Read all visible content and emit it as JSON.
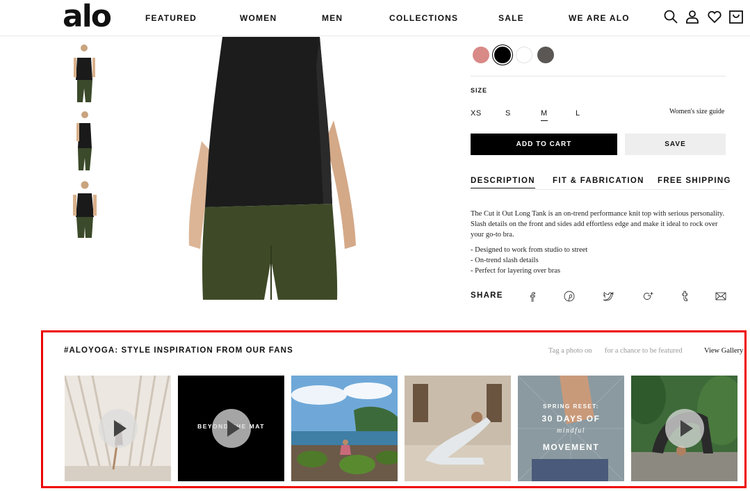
{
  "header": {
    "logo": "alo",
    "nav": [
      "FEATURED",
      "WOMEN",
      "MEN",
      "COLLECTIONS",
      "SALE",
      "WE ARE ALO"
    ],
    "icons": [
      "search-icon",
      "account-icon",
      "wishlist-icon",
      "cart-icon"
    ]
  },
  "product": {
    "colors": [
      "#d98a87",
      "#000000",
      "#ffffff",
      "#5a5754"
    ],
    "selected_color_index": 1,
    "size_label": "SIZE",
    "sizes": [
      "XS",
      "S",
      "M",
      "L"
    ],
    "selected_size": "M",
    "size_guide": "Women's size guide",
    "add_to_cart": "ADD TO CART",
    "save": "SAVE",
    "tabs": [
      "DESCRIPTION",
      "FIT & FABRICATION",
      "FREE SHIPPING"
    ],
    "active_tab": "DESCRIPTION",
    "description": "The Cut it Out Long Tank is an on-trend performance knit top with serious personality. Slash details on the front and sides add effortless edge and make it ideal to rock over your go-to bra.",
    "bullets": [
      "- Designed to work from studio to street",
      "- On-trend slash details",
      "- Perfect for layering over bras"
    ],
    "share_label": "SHARE",
    "share_icons": [
      "facebook-icon",
      "pinterest-icon",
      "twitter-icon",
      "google-plus-icon",
      "tumblr-icon",
      "email-icon"
    ]
  },
  "inspiration": {
    "title": "#ALOYOGA: STYLE INSPIRATION FROM OUR FANS",
    "tag_text": "Tag a photo on",
    "chance_text": "for a chance to be featured",
    "view_gallery": "View Gallery",
    "photos": [
      {
        "name": "photo-1",
        "video": true,
        "text": ""
      },
      {
        "name": "photo-2",
        "video": true,
        "text": "BEYOND THE MAT"
      },
      {
        "name": "photo-3",
        "video": false,
        "text": ""
      },
      {
        "name": "photo-4",
        "video": false,
        "text": ""
      },
      {
        "name": "photo-5",
        "video": false,
        "text_lines": [
          "SPRING RESET:",
          "30 DAYS OF",
          "mindful",
          "MOVEMENT"
        ]
      },
      {
        "name": "photo-6",
        "video": true,
        "text": ""
      }
    ]
  }
}
